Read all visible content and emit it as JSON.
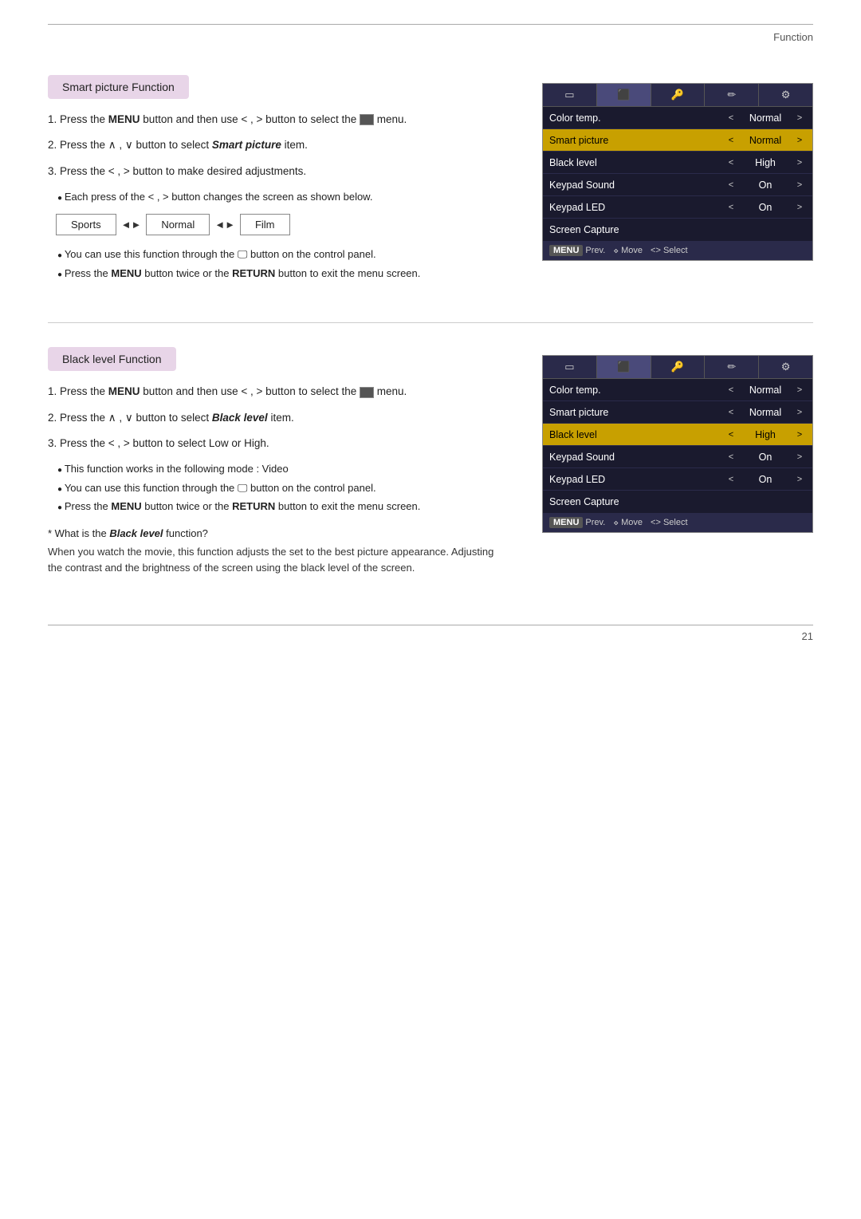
{
  "page": {
    "header": "Function",
    "page_number": "21"
  },
  "smart_picture": {
    "title": "Smart picture Function",
    "steps": [
      {
        "id": "step1",
        "text_before": "Press the ",
        "bold": "MENU",
        "text_middle": " button and then use ",
        "symbols": "< , >",
        "text_after": " button to select the",
        "icon": "⬛",
        "text_end": " menu."
      },
      {
        "id": "step2",
        "text_before": "Press the ",
        "symbols": "∧ , ∨",
        "text_middle": " button to select ",
        "bold_italic": "Smart picture",
        "text_after": " item."
      },
      {
        "id": "step3",
        "text_before": "Press the ",
        "symbols": "< , >",
        "text_after": " button to make desired adjustments."
      }
    ],
    "bullet1": "Each press of the < , > button changes the screen as shown below.",
    "modes": [
      "Sports",
      "Normal",
      "Film"
    ],
    "bullet2": "You can use this function through the 🖵 button on the control panel.",
    "bullet3": "Press the MENU button twice or the RETURN button to exit the menu screen."
  },
  "black_level": {
    "title": "Black level Function",
    "steps": [
      {
        "id": "step1",
        "text_before": "Press the ",
        "bold": "MENU",
        "text_middle": " button and then use ",
        "symbols": "< , >",
        "text_after": " button to select the",
        "icon": "⬛",
        "text_end": " menu."
      },
      {
        "id": "step2",
        "text_before": "Press the ",
        "symbols": "∧ , ∨",
        "text_middle": " button to select ",
        "bold_italic": "Black level",
        "text_after": " item."
      },
      {
        "id": "step3",
        "text_before": "Press the ",
        "symbols": "< , >",
        "text_after": " button to select Low or High."
      }
    ],
    "bullets": [
      "This function works in the following mode : Video",
      "You can use this function through the 🖵 button on the control panel.",
      "Press the MENU button twice or the RETURN button to exit the menu screen."
    ],
    "what_is_label": "* What is the",
    "what_is_bold": "Black level",
    "what_is_end": "function?",
    "what_is_body": "When you watch the movie, this function adjusts the set to the best picture appearance. Adjusting the contrast and the brightness of the screen using the black level of the screen."
  },
  "osd_smart": {
    "tabs": [
      "□",
      "⬛",
      "🔑",
      "✏",
      "⚙"
    ],
    "active_tab": 1,
    "rows": [
      {
        "label": "Color temp.",
        "left_arrow": "<",
        "value": "Normal",
        "right_arrow": ">",
        "highlighted": false
      },
      {
        "label": "Smart picture",
        "left_arrow": "<",
        "value": "Normal",
        "right_arrow": ">",
        "highlighted": true
      },
      {
        "label": "Black level",
        "left_arrow": "<",
        "value": "High",
        "right_arrow": ">",
        "highlighted": false
      },
      {
        "label": "Keypad Sound",
        "left_arrow": "<",
        "value": "On",
        "right_arrow": ">",
        "highlighted": false
      },
      {
        "label": "Keypad LED",
        "left_arrow": "<",
        "value": "On",
        "right_arrow": ">",
        "highlighted": false
      },
      {
        "label": "Screen Capture",
        "left_arrow": "",
        "value": "",
        "right_arrow": "",
        "highlighted": false
      }
    ],
    "footer": {
      "prev_label": "MENU",
      "prev_text": "Prev.",
      "move_icon": "⋄",
      "move_text": "Move",
      "select_text": "<> Select"
    }
  },
  "osd_black": {
    "tabs": [
      "□",
      "⬛",
      "🔑",
      "✏",
      "⚙"
    ],
    "active_tab": 1,
    "rows": [
      {
        "label": "Color temp.",
        "left_arrow": "<",
        "value": "Normal",
        "right_arrow": ">",
        "highlighted": false
      },
      {
        "label": "Smart picture",
        "left_arrow": "<",
        "value": "Normal",
        "right_arrow": ">",
        "highlighted": false
      },
      {
        "label": "Black level",
        "left_arrow": "<",
        "value": "High",
        "right_arrow": ">",
        "highlighted": true
      },
      {
        "label": "Keypad Sound",
        "left_arrow": "<",
        "value": "On",
        "right_arrow": ">",
        "highlighted": false
      },
      {
        "label": "Keypad LED",
        "left_arrow": "<",
        "value": "On",
        "right_arrow": ">",
        "highlighted": false
      },
      {
        "label": "Screen Capture",
        "left_arrow": "",
        "value": "",
        "right_arrow": "",
        "highlighted": false
      }
    ],
    "footer": {
      "prev_label": "MENU",
      "prev_text": "Prev.",
      "move_icon": "⋄",
      "move_text": "Move",
      "select_text": "<> Select"
    }
  }
}
